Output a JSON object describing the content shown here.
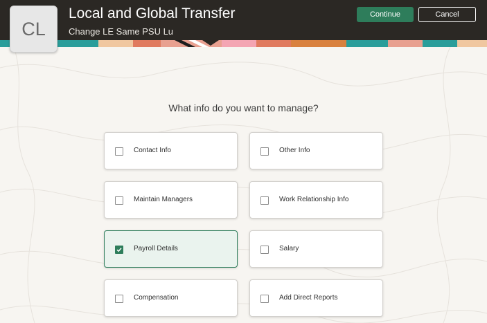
{
  "header": {
    "avatar_initials": "CL",
    "title": "Local and Global Transfer",
    "subtitle": "Change LE Same PSU Lu",
    "continue_label": "Continue",
    "cancel_label": "Cancel"
  },
  "main": {
    "question": "What info do you want to manage?",
    "options": [
      {
        "label": "Contact Info",
        "checked": false
      },
      {
        "label": "Other Info",
        "checked": false
      },
      {
        "label": "Maintain Managers",
        "checked": false
      },
      {
        "label": "Work Relationship Info",
        "checked": false
      },
      {
        "label": "Payroll Details",
        "checked": true
      },
      {
        "label": "Salary",
        "checked": false
      },
      {
        "label": "Compensation",
        "checked": false
      },
      {
        "label": "Add Direct Reports",
        "checked": false
      }
    ]
  },
  "colors": {
    "header_bg": "#2b2824",
    "accent": "#2e7d5b",
    "selected_bg": "#eaf3ee"
  }
}
